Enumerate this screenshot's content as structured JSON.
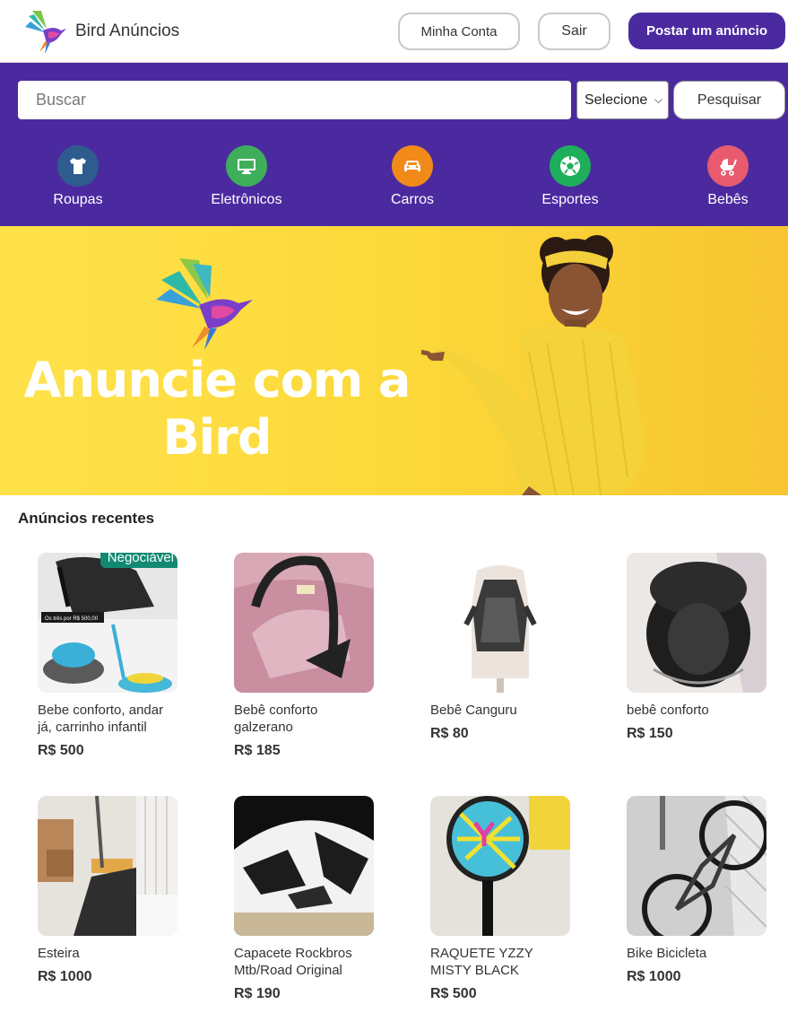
{
  "header": {
    "brand_name": "Bird Anúncios",
    "account_label": "Minha Conta",
    "logout_label": "Sair",
    "post_label": "Postar um anúncio"
  },
  "search": {
    "placeholder": "Buscar",
    "select_value": "Selecione",
    "button_label": "Pesquisar"
  },
  "categories": [
    {
      "label": "Roupas",
      "icon": "shirt-icon",
      "color": "#2f5c8f"
    },
    {
      "label": "Eletrônicos",
      "icon": "monitor-icon",
      "color": "#3fae5a"
    },
    {
      "label": "Carros",
      "icon": "car-icon",
      "color": "#f28a1a"
    },
    {
      "label": "Esportes",
      "icon": "soccer-ball-icon",
      "color": "#1fae5b"
    },
    {
      "label": "Bebês",
      "icon": "stroller-icon",
      "color": "#e85a6e"
    }
  ],
  "hero": {
    "title": "Anuncie com a Bird"
  },
  "listings_title": "Anúncios recentes",
  "listings": [
    {
      "title": "Bebe conforto, andar já, carrinho infantil",
      "price": "R$ 500",
      "badge": "Negociável",
      "photo_text": "Os três por R$ 500,00"
    },
    {
      "title": "Bebê conforto galzerano",
      "price": "R$ 185"
    },
    {
      "title": "Bebê Canguru",
      "price": "R$ 80"
    },
    {
      "title": "bebê conforto",
      "price": "R$ 150"
    },
    {
      "title": "Esteira",
      "price": "R$ 1000"
    },
    {
      "title": "Capacete Rockbros Mtb/Road Original",
      "price": "R$ 190"
    },
    {
      "title": "RAQUETE YZZY MISTY BLACK",
      "price": "R$ 500"
    },
    {
      "title": "Bike Bicicleta",
      "price": "R$ 1000"
    }
  ],
  "colors": {
    "brand_purple": "#4b2aa0",
    "badge_green": "#128a72"
  }
}
